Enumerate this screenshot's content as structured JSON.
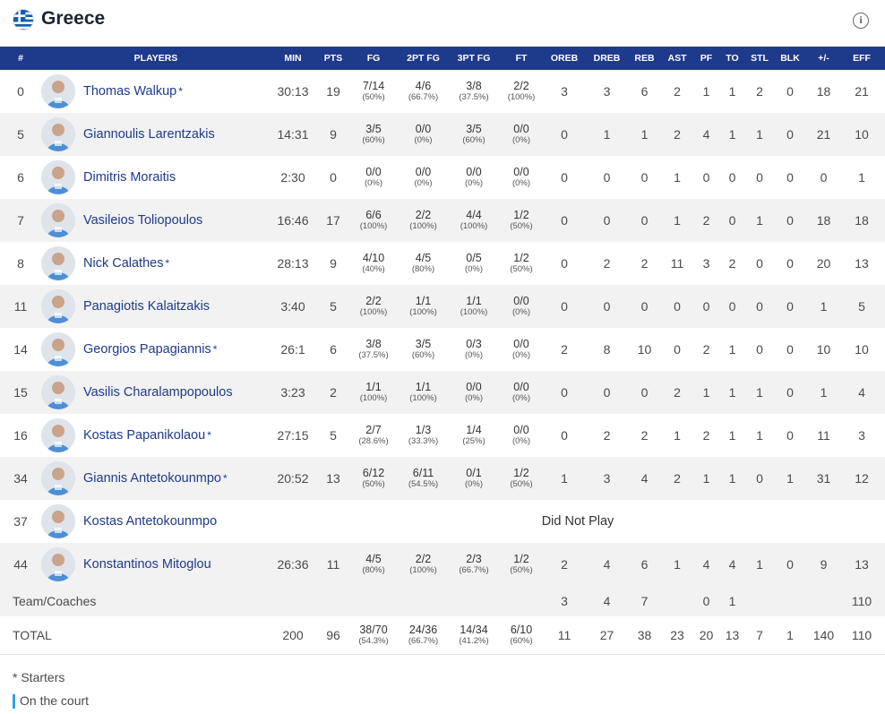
{
  "team": {
    "name": "Greece",
    "flag_icon": "greece-flag-icon",
    "info_icon": "info-icon"
  },
  "colors": {
    "header_bg": "#1e3a8a",
    "player_name": "#1e3a8a",
    "on_court": "#2aa6de"
  },
  "columns": [
    "#",
    "PLAYERS",
    "MIN",
    "PTS",
    "FG",
    "2PT FG",
    "3PT FG",
    "FT",
    "OREB",
    "DREB",
    "REB",
    "AST",
    "PF",
    "TO",
    "STL",
    "BLK",
    "+/-",
    "EFF"
  ],
  "players": [
    {
      "no": "0",
      "name": "Thomas Walkup",
      "starter": "*",
      "min": "30:13",
      "pts": "19",
      "fg": "7/14",
      "fg_pct": "(50%)",
      "fg2": "4/6",
      "fg2_pct": "(66.7%)",
      "fg3": "3/8",
      "fg3_pct": "(37.5%)",
      "ft": "2/2",
      "ft_pct": "(100%)",
      "oreb": "3",
      "dreb": "3",
      "reb": "6",
      "ast": "2",
      "pf": "1",
      "to": "1",
      "stl": "2",
      "blk": "0",
      "pm": "18",
      "eff": "21"
    },
    {
      "no": "5",
      "name": "Giannoulis Larentzakis",
      "starter": "",
      "min": "14:31",
      "pts": "9",
      "fg": "3/5",
      "fg_pct": "(60%)",
      "fg2": "0/0",
      "fg2_pct": "(0%)",
      "fg3": "3/5",
      "fg3_pct": "(60%)",
      "ft": "0/0",
      "ft_pct": "(0%)",
      "oreb": "0",
      "dreb": "1",
      "reb": "1",
      "ast": "2",
      "pf": "4",
      "to": "1",
      "stl": "1",
      "blk": "0",
      "pm": "21",
      "eff": "10"
    },
    {
      "no": "6",
      "name": "Dimitris Moraitis",
      "starter": "",
      "min": "2:30",
      "pts": "0",
      "fg": "0/0",
      "fg_pct": "(0%)",
      "fg2": "0/0",
      "fg2_pct": "(0%)",
      "fg3": "0/0",
      "fg3_pct": "(0%)",
      "ft": "0/0",
      "ft_pct": "(0%)",
      "oreb": "0",
      "dreb": "0",
      "reb": "0",
      "ast": "1",
      "pf": "0",
      "to": "0",
      "stl": "0",
      "blk": "0",
      "pm": "0",
      "eff": "1"
    },
    {
      "no": "7",
      "name": "Vasileios Toliopoulos",
      "starter": "",
      "min": "16:46",
      "pts": "17",
      "fg": "6/6",
      "fg_pct": "(100%)",
      "fg2": "2/2",
      "fg2_pct": "(100%)",
      "fg3": "4/4",
      "fg3_pct": "(100%)",
      "ft": "1/2",
      "ft_pct": "(50%)",
      "oreb": "0",
      "dreb": "0",
      "reb": "0",
      "ast": "1",
      "pf": "2",
      "to": "0",
      "stl": "1",
      "blk": "0",
      "pm": "18",
      "eff": "18"
    },
    {
      "no": "8",
      "name": "Nick Calathes",
      "starter": "*",
      "min": "28:13",
      "pts": "9",
      "fg": "4/10",
      "fg_pct": "(40%)",
      "fg2": "4/5",
      "fg2_pct": "(80%)",
      "fg3": "0/5",
      "fg3_pct": "(0%)",
      "ft": "1/2",
      "ft_pct": "(50%)",
      "oreb": "0",
      "dreb": "2",
      "reb": "2",
      "ast": "11",
      "pf": "3",
      "to": "2",
      "stl": "0",
      "blk": "0",
      "pm": "20",
      "eff": "13"
    },
    {
      "no": "11",
      "name": "Panagiotis Kalaitzakis",
      "starter": "",
      "min": "3:40",
      "pts": "5",
      "fg": "2/2",
      "fg_pct": "(100%)",
      "fg2": "1/1",
      "fg2_pct": "(100%)",
      "fg3": "1/1",
      "fg3_pct": "(100%)",
      "ft": "0/0",
      "ft_pct": "(0%)",
      "oreb": "0",
      "dreb": "0",
      "reb": "0",
      "ast": "0",
      "pf": "0",
      "to": "0",
      "stl": "0",
      "blk": "0",
      "pm": "1",
      "eff": "5"
    },
    {
      "no": "14",
      "name": "Georgios Papagiannis",
      "starter": "*",
      "min": "26:1",
      "pts": "6",
      "fg": "3/8",
      "fg_pct": "(37.5%)",
      "fg2": "3/5",
      "fg2_pct": "(60%)",
      "fg3": "0/3",
      "fg3_pct": "(0%)",
      "ft": "0/0",
      "ft_pct": "(0%)",
      "oreb": "2",
      "dreb": "8",
      "reb": "10",
      "ast": "0",
      "pf": "2",
      "to": "1",
      "stl": "0",
      "blk": "0",
      "pm": "10",
      "eff": "10"
    },
    {
      "no": "15",
      "name": "Vasilis Charalampopoulos",
      "starter": "",
      "min": "3:23",
      "pts": "2",
      "fg": "1/1",
      "fg_pct": "(100%)",
      "fg2": "1/1",
      "fg2_pct": "(100%)",
      "fg3": "0/0",
      "fg3_pct": "(0%)",
      "ft": "0/0",
      "ft_pct": "(0%)",
      "oreb": "0",
      "dreb": "0",
      "reb": "0",
      "ast": "2",
      "pf": "1",
      "to": "1",
      "stl": "1",
      "blk": "0",
      "pm": "1",
      "eff": "4"
    },
    {
      "no": "16",
      "name": "Kostas Papanikolaou",
      "starter": "*",
      "min": "27:15",
      "pts": "5",
      "fg": "2/7",
      "fg_pct": "(28.6%)",
      "fg2": "1/3",
      "fg2_pct": "(33.3%)",
      "fg3": "1/4",
      "fg3_pct": "(25%)",
      "ft": "0/0",
      "ft_pct": "(0%)",
      "oreb": "0",
      "dreb": "2",
      "reb": "2",
      "ast": "1",
      "pf": "2",
      "to": "1",
      "stl": "1",
      "blk": "0",
      "pm": "11",
      "eff": "3"
    },
    {
      "no": "34",
      "name": "Giannis Antetokounmpo",
      "starter": "*",
      "min": "20:52",
      "pts": "13",
      "fg": "6/12",
      "fg_pct": "(50%)",
      "fg2": "6/11",
      "fg2_pct": "(54.5%)",
      "fg3": "0/1",
      "fg3_pct": "(0%)",
      "ft": "1/2",
      "ft_pct": "(50%)",
      "oreb": "1",
      "dreb": "3",
      "reb": "4",
      "ast": "2",
      "pf": "1",
      "to": "1",
      "stl": "0",
      "blk": "1",
      "pm": "31",
      "eff": "12"
    },
    {
      "no": "37",
      "name": "Kostas Antetokounmpo",
      "starter": "",
      "dnp": "Did Not Play"
    },
    {
      "no": "44",
      "name": "Konstantinos Mitoglou",
      "starter": "",
      "min": "26:36",
      "pts": "11",
      "fg": "4/5",
      "fg_pct": "(80%)",
      "fg2": "2/2",
      "fg2_pct": "(100%)",
      "fg3": "2/3",
      "fg3_pct": "(66.7%)",
      "ft": "1/2",
      "ft_pct": "(50%)",
      "oreb": "2",
      "dreb": "4",
      "reb": "6",
      "ast": "1",
      "pf": "4",
      "to": "4",
      "stl": "1",
      "blk": "0",
      "pm": "9",
      "eff": "13"
    }
  ],
  "team_coaches": {
    "label": "Team/Coaches",
    "oreb": "3",
    "dreb": "4",
    "reb": "7",
    "ast": "",
    "pf": "0",
    "to": "1",
    "stl": "",
    "blk": "",
    "pm": "",
    "eff": "110"
  },
  "total": {
    "label": "TOTAL",
    "min": "200",
    "pts": "96",
    "fg": "38/70",
    "fg_pct": "(54.3%)",
    "fg2": "24/36",
    "fg2_pct": "(66.7%)",
    "fg3": "14/34",
    "fg3_pct": "(41.2%)",
    "ft": "6/10",
    "ft_pct": "(60%)",
    "oreb": "11",
    "dreb": "27",
    "reb": "38",
    "ast": "23",
    "pf": "20",
    "to": "13",
    "stl": "7",
    "blk": "1",
    "pm": "140",
    "eff": "110"
  },
  "legend": {
    "starters": "* Starters",
    "on_court": "On the court"
  }
}
